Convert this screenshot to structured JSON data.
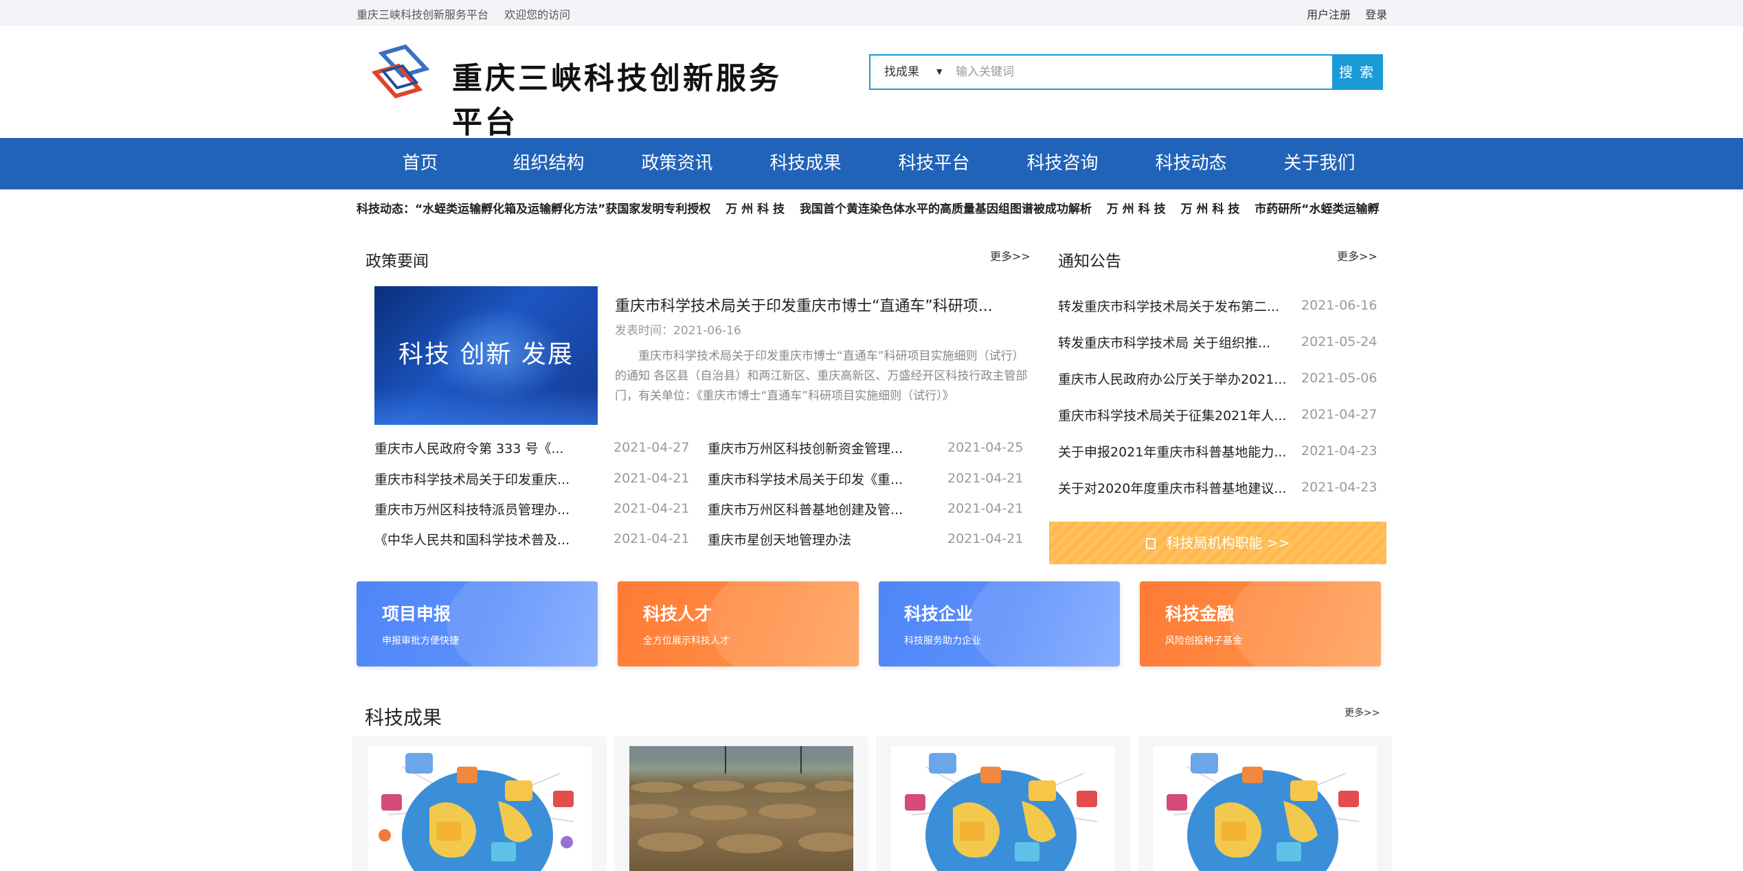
{
  "topbar": {
    "site_name": "重庆三峡科技创新服务平台",
    "welcome": "欢迎您的访问",
    "register": "用户注册",
    "login": "登录"
  },
  "header": {
    "logo_text": "重庆三峡科技创新服务平台",
    "search": {
      "category": "找成果",
      "placeholder": "输入关键词",
      "button": "搜 索"
    }
  },
  "nav": {
    "items": [
      "首页",
      "组织结构",
      "政策资讯",
      "科技成果",
      "科技平台",
      "科技咨询",
      "科技动态",
      "关于我们"
    ]
  },
  "ticker": {
    "items": [
      "科技动态：“水蛭类运输孵化箱及运输孵化方法”获国家发明专利授权",
      "万 州 科 技",
      "我国首个黄连染色体水平的高质量基因组图谱被成功解析",
      "万 州 科 技",
      "万 州 科 技",
      "市药研所“水蛭类运输孵"
    ]
  },
  "policy": {
    "title": "政策要闻",
    "more": "更多>>",
    "feature": {
      "image_text": "科技 创新 发展",
      "title": "重庆市科学技术局关于印发重庆市博士“直通车”科研项...",
      "date": "发表时间：2021-06-16",
      "summary": "重庆市科学技术局关于印发重庆市博士“直通车”科研项目实施细则（试行）的通知 各区县（自治县）和两江新区、重庆高新区、万盛经开区科技行政主管部门，有关单位：《重庆市博士“直通车”科研项目实施细则（试行）》"
    },
    "list_left": [
      {
        "title": "重庆市人民政府令第 333 号《...",
        "date": "2021-04-27"
      },
      {
        "title": "重庆市科学技术局关于印发重庆...",
        "date": "2021-04-21"
      },
      {
        "title": "重庆市万州区科技特派员管理办...",
        "date": "2021-04-21"
      },
      {
        "title": "《中华人民共和国科学技术普及...",
        "date": "2021-04-21"
      }
    ],
    "list_right": [
      {
        "title": "重庆市万州区科技创新资金管理...",
        "date": "2021-04-25"
      },
      {
        "title": "重庆市科学技术局关于印发《重...",
        "date": "2021-04-21"
      },
      {
        "title": "重庆市万州区科普基地创建及管...",
        "date": "2021-04-21"
      },
      {
        "title": "重庆市星创天地管理办法",
        "date": "2021-04-21"
      }
    ]
  },
  "notice": {
    "title": "通知公告",
    "more": "更多>>",
    "items": [
      {
        "title": "转发重庆市科学技术局关于发布第二...",
        "date": "2021-06-16"
      },
      {
        "title": "转发重庆市科学技术局 关于组织推...",
        "date": "2021-05-24"
      },
      {
        "title": "重庆市人民政府办公厅关于举办2021...",
        "date": "2021-05-06"
      },
      {
        "title": "重庆市科学技术局关于征集2021年人...",
        "date": "2021-04-27"
      },
      {
        "title": "关于申报2021年重庆市科普基地能力...",
        "date": "2021-04-23"
      },
      {
        "title": "关于对2020年度重庆市科普基地建议...",
        "date": "2021-04-23"
      }
    ],
    "function_button": "科技局机构职能 >>"
  },
  "cards": [
    {
      "title": "项目申报",
      "subtitle": "申报审批方便快捷",
      "color": "#4f86f7"
    },
    {
      "title": "科技人才",
      "subtitle": "全方位展示科技人才",
      "color": "#ff7a35"
    },
    {
      "title": "科技企业",
      "subtitle": "科技服务助力企业",
      "color": "#4f86f7"
    },
    {
      "title": "科技金融",
      "subtitle": "风险创投种子基金",
      "color": "#ff7a35"
    }
  ],
  "achievements": {
    "title": "科技成果",
    "more": "更多>>",
    "items": [
      {
        "image": "globe-network-illustration"
      },
      {
        "image": "field-photo"
      },
      {
        "image": "globe-network-illustration"
      },
      {
        "image": "globe-network-illustration"
      }
    ]
  },
  "colors": {
    "nav_bg": "#2163b8",
    "search_accent": "#1a9ad6",
    "function_button": "#ffb84d"
  }
}
